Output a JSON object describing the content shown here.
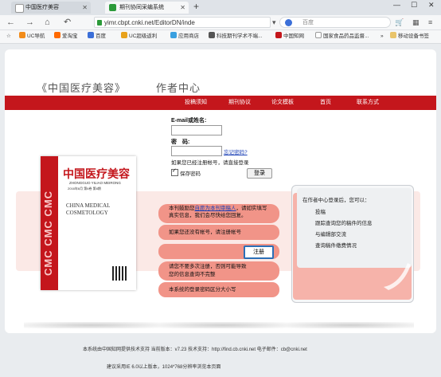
{
  "browser": {
    "tabs": [
      {
        "title": "中国医疗美容"
      },
      {
        "title": "期刊协同采编系统"
      }
    ],
    "url": "yimr.cbpt.cnki.net/EditorDN/inde",
    "search_placeholder": "百度",
    "bookmarks": [
      "UC导航",
      "爱淘宝",
      "百度",
      "UC超级返利",
      "应用商店",
      "科技期刊学术不端...",
      "中国知网",
      "国家食品药品监督...",
      "移动设备书签"
    ]
  },
  "header": {
    "journal_title": "《中国医疗美容》",
    "center_title": "作者中心"
  },
  "menu": [
    "投稿须知",
    "期刊协议",
    "论文模板",
    "首页",
    "联系方式"
  ],
  "login": {
    "email_label": "E-mail或姓名:",
    "password_label": "密　码:",
    "forgot_link": "忘记密码?",
    "register_hint": "如果您已经注册帐号，请直接登录",
    "remember_label": "保存密码",
    "login_button": "登录"
  },
  "cover": {
    "title_cn": "中国医疗美容",
    "pinyin": "ZHONGGUO YILIAO MEIRONG",
    "issue": "2016年8月  第6卷  第8期",
    "title_en_1": "CHINA MEDICAL",
    "title_en_2": "COSMETOLOGY",
    "spine": "CMC CMC CMC"
  },
  "notices": {
    "line1_pre": "本刊鼓励您",
    "line1_link": "自愿为本刊审稿人",
    "line1_post": "，请如实填写",
    "line2": "真实信息，我们会尽快给您回复。",
    "line3": "如果您还没有帐号，请注册帐号",
    "register_button": "注册",
    "line4": "请您不要多次注册，否则可能导致",
    "line5": "您的信息查询不完整",
    "line6": "本系统的登录密码区分大小写"
  },
  "after_login": {
    "heading": "在作者中心登录后，您可以：",
    "items": [
      "投稿",
      "跟踪查询您的稿件的信息",
      "与编辑部交流",
      "查询稿件缴费情况"
    ]
  },
  "footer": {
    "line1": "本系统由中国知网提供技术支持  当前版本：v7.23  技术支持：http://find.cb.cnki.net  电子邮件：cb@cnki.net",
    "line2": "建议采用IE 6.0以上版本，1024*768分辨率浏览本页面"
  }
}
